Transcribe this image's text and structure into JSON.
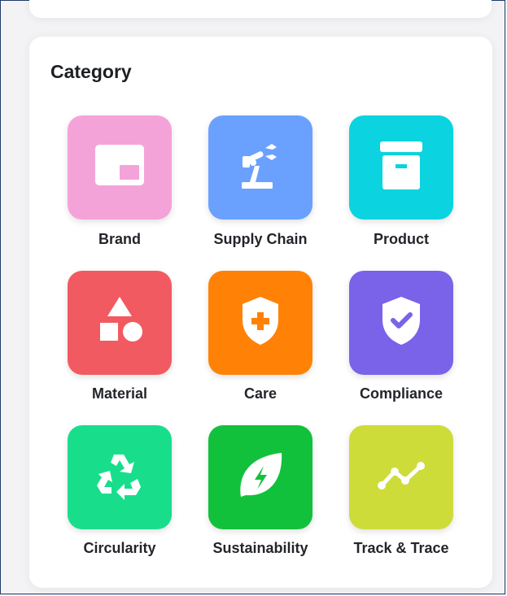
{
  "section": {
    "title": "Category"
  },
  "categories": [
    {
      "label": "Brand",
      "icon": "brand-icon",
      "color": "#f4a3d8"
    },
    {
      "label": "Supply Chain",
      "icon": "robot-arm-icon",
      "color": "#6aa1ff"
    },
    {
      "label": "Product",
      "icon": "archive-box-icon",
      "color": "#0bd3df"
    },
    {
      "label": "Material",
      "icon": "shapes-icon",
      "color": "#f25a62"
    },
    {
      "label": "Care",
      "icon": "shield-plus-icon",
      "color": "#ff8206"
    },
    {
      "label": "Compliance",
      "icon": "shield-check-icon",
      "color": "#7a63e8"
    },
    {
      "label": "Circularity",
      "icon": "recycle-icon",
      "color": "#18de8c"
    },
    {
      "label": "Sustainability",
      "icon": "leaf-bolt-icon",
      "color": "#12c13b"
    },
    {
      "label": "Track & Trace",
      "icon": "trend-line-icon",
      "color": "#cddc39"
    }
  ]
}
